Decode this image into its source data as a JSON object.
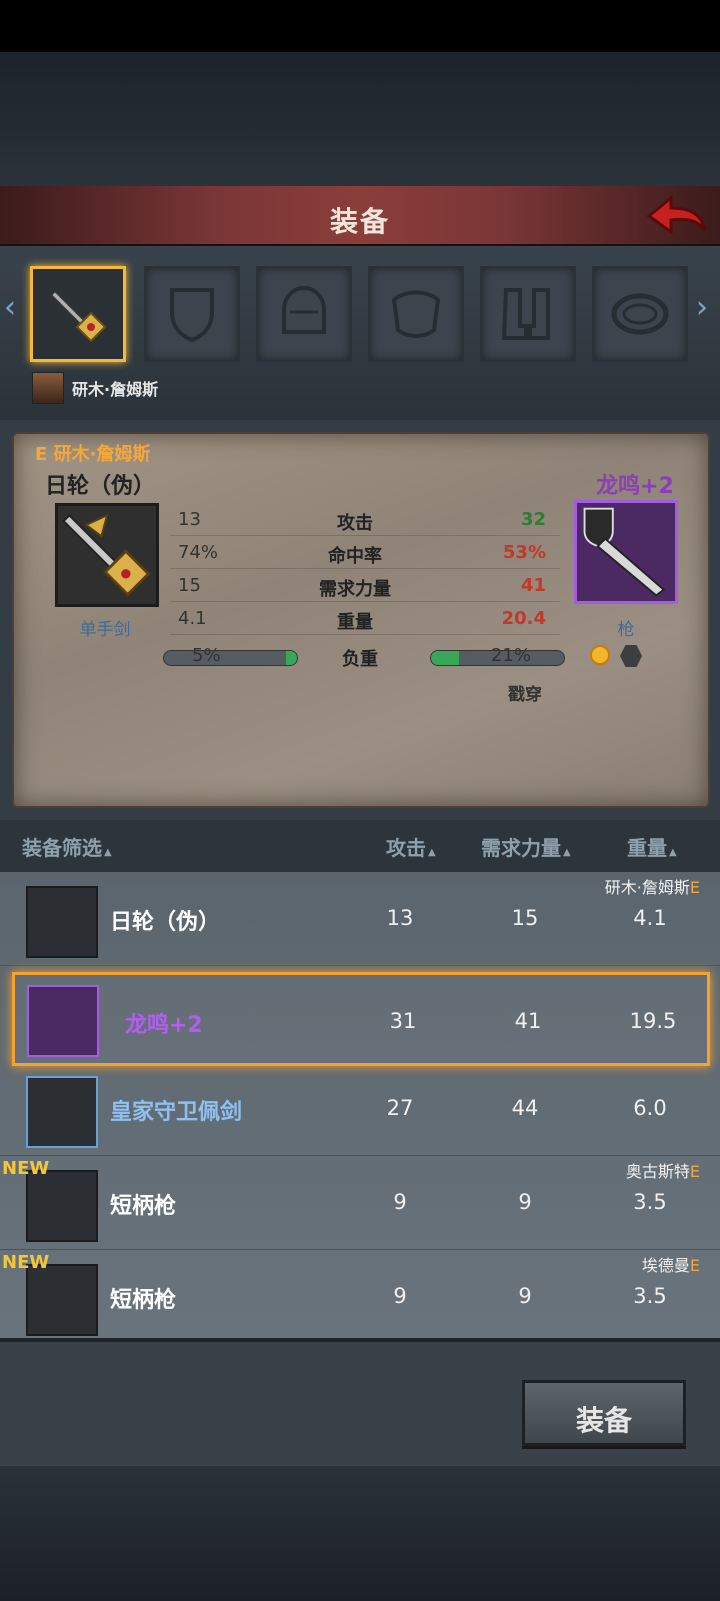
{
  "header": {
    "title": "装备"
  },
  "character": {
    "name": "研木·詹姆斯"
  },
  "compare": {
    "owner_prefix": "E",
    "owner": "研木·詹姆斯",
    "current": {
      "name": "日轮（伪）",
      "type": "单手剑"
    },
    "candidate": {
      "name": "龙鸣+2",
      "type": "枪"
    },
    "stats": [
      {
        "left": "13",
        "label": "攻击",
        "right": "32",
        "right_color": "#2f7d32"
      },
      {
        "left": "74%",
        "label": "命中率",
        "right": "53%",
        "right_color": "#c0392b"
      },
      {
        "left": "15",
        "label": "需求力量",
        "right": "41",
        "right_color": "#c0392b"
      },
      {
        "left": "4.1",
        "label": "重量",
        "right": "20.4",
        "right_color": "#c0392b"
      }
    ],
    "load": {
      "label": "负重",
      "left_text": "5%",
      "left_fill": 0.05,
      "right_text": "21%",
      "right_fill": 0.21
    },
    "special": "戳穿"
  },
  "list_header": {
    "filter": "装备筛选",
    "attack": "攻击",
    "strength": "需求力量",
    "weight": "重量"
  },
  "items": [
    {
      "name": "日轮（伪）",
      "attack": "13",
      "strength": "15",
      "weight": "4.1",
      "owner": "研木·詹姆斯",
      "owner_e": "E",
      "new": "",
      "name_color": "#ffffff"
    },
    {
      "name": "龙鸣+2",
      "attack": "31",
      "strength": "41",
      "weight": "19.5",
      "owner": "",
      "owner_e": "",
      "new": "",
      "name_color": "#b35ef0"
    },
    {
      "name": "皇家守卫佩剑",
      "attack": "27",
      "strength": "44",
      "weight": "6.0",
      "owner": "",
      "owner_e": "",
      "new": "",
      "name_color": "#8fc0f0"
    },
    {
      "name": "短柄枪",
      "attack": "9",
      "strength": "9",
      "weight": "3.5",
      "owner": "奥古斯特",
      "owner_e": "E",
      "new": "NEW",
      "name_color": "#ffffff"
    },
    {
      "name": "短柄枪",
      "attack": "9",
      "strength": "9",
      "weight": "3.5",
      "owner": "埃德曼",
      "owner_e": "E",
      "new": "NEW",
      "name_color": "#ffffff"
    }
  ],
  "footer": {
    "equip_label": "装备"
  },
  "icons": [
    "back-arrow-icon",
    "sword-slot-icon",
    "shield-slot-icon",
    "helmet-slot-icon",
    "armor-slot-icon",
    "boots-slot-icon",
    "ring-slot-icon",
    "chevron-left-icon",
    "chevron-right-icon"
  ]
}
